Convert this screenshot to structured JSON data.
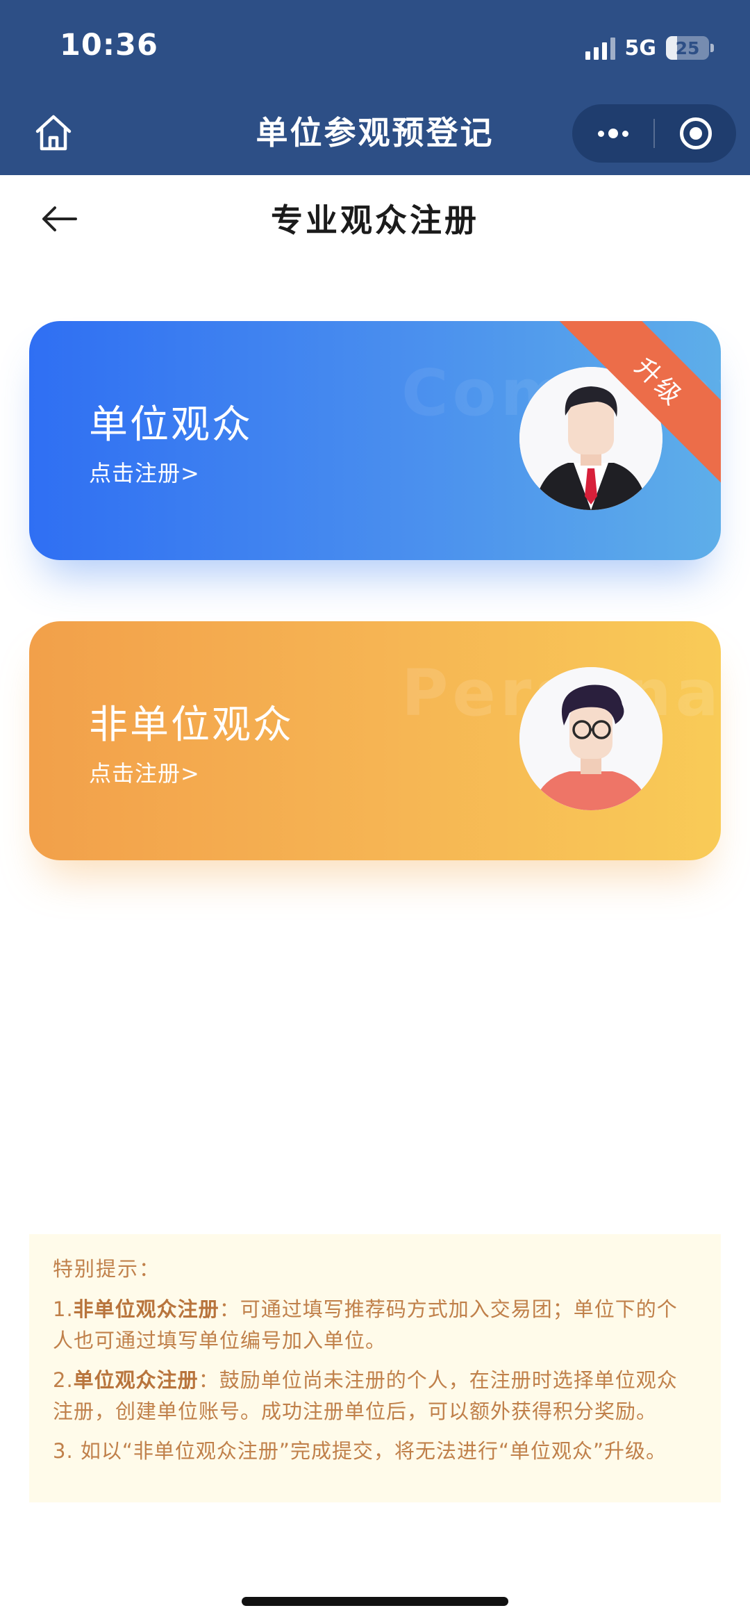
{
  "status_bar": {
    "time": "10:36",
    "network": "5G",
    "battery": "25",
    "battery_level": 0.25
  },
  "nav": {
    "title": "单位参观预登记"
  },
  "page": {
    "title": "专业观众注册"
  },
  "cards": [
    {
      "title": "单位观众",
      "subtitle": "点击注册>",
      "watermark": "Company",
      "badge": "升级",
      "avatar": "businessman-avatar"
    },
    {
      "title": "非单位观众",
      "subtitle": "点击注册>",
      "watermark": "Personal",
      "avatar": "person-with-glasses-avatar"
    }
  ],
  "notice": {
    "title": "特别提示：",
    "items": [
      {
        "prefix": "1.",
        "bold": "非单位观众注册",
        "text": "：可通过填写推荐码方式加入交易团；单位下的个人也可通过填写单位编号加入单位。"
      },
      {
        "prefix": "2.",
        "bold": "单位观众注册",
        "text": "：鼓励单位尚未注册的个人，在注册时选择单位观众注册，创建单位账号。成功注册单位后，可以额外获得积分奖励。"
      },
      {
        "prefix": "3. ",
        "text": "如以“非单位观众注册”完成提交，将无法进行“单位观众”升级。"
      }
    ]
  },
  "colors": {
    "header_bg": "#2d4f86",
    "blue_card_start": "#2f6ff3",
    "blue_card_end": "#5eaee9",
    "orange_card_start": "#f2a04a",
    "orange_card_end": "#f9cb57",
    "ribbon": "#ec6d49",
    "notice_bg": "#fffbea",
    "notice_text": "#c0804a"
  }
}
